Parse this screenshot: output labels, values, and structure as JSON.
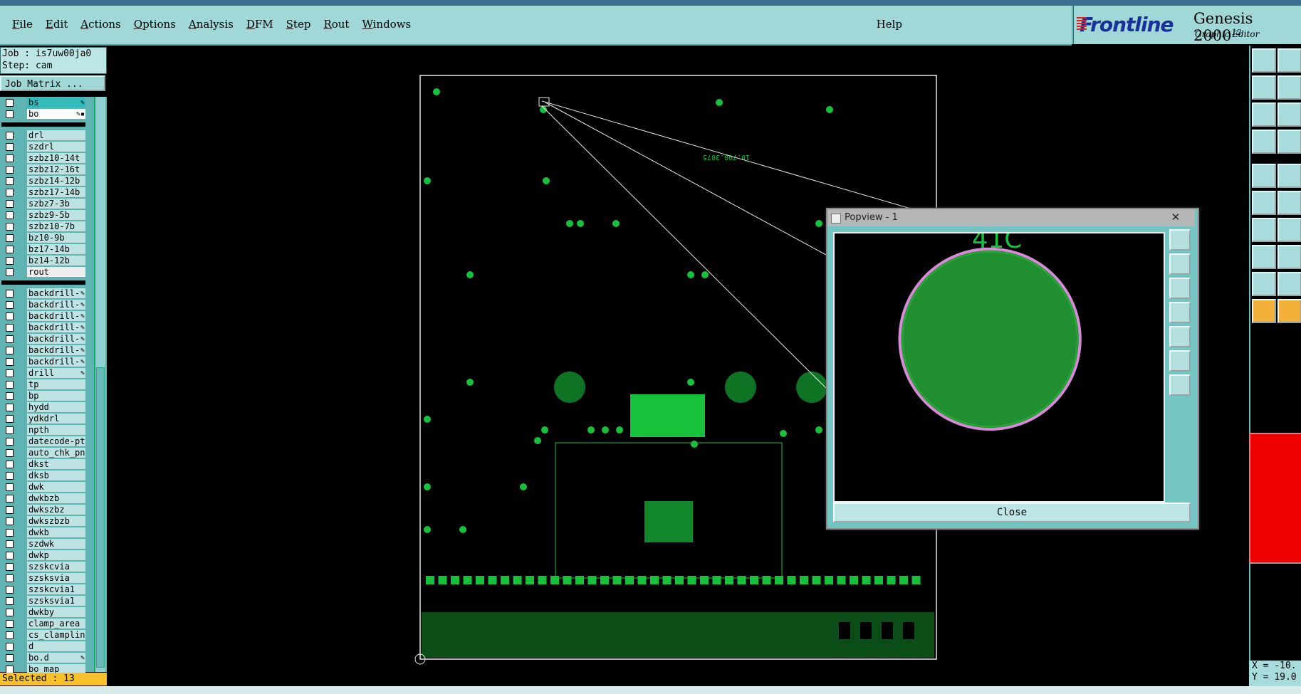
{
  "menu": {
    "items": [
      "File",
      "Edit",
      "Actions",
      "Options",
      "Analysis",
      "DFM",
      "Step",
      "Rout",
      "Windows"
    ],
    "help": "Help"
  },
  "brand": {
    "logo": "Frontline",
    "product": "Genesis 2000",
    "sup": "12",
    "subtitle": "Graphic Editor"
  },
  "job": {
    "job_line": "Job : is7uw00ja0",
    "step_line": "Step: cam"
  },
  "job_matrix_label": "Job Matrix ...",
  "layers_group1": [
    {
      "name": "bs",
      "mark": "✎",
      "style": "bs"
    },
    {
      "name": "bo",
      "mark": "✎▪",
      "style": "sel"
    }
  ],
  "layers_group2": [
    {
      "name": "drl"
    },
    {
      "name": "szdrl"
    },
    {
      "name": "szbz10-14t"
    },
    {
      "name": "szbz12-16t"
    },
    {
      "name": "szbz14-12b"
    },
    {
      "name": "szbz17-14b"
    },
    {
      "name": "szbz7-3b"
    },
    {
      "name": "szbz9-5b"
    },
    {
      "name": "szbz10-7b"
    },
    {
      "name": "bz10-9b"
    },
    {
      "name": "bz17-14b"
    },
    {
      "name": "bz14-12b"
    },
    {
      "name": "rout",
      "style": "rout"
    }
  ],
  "layers_group3": [
    {
      "name": "backdrill-",
      "mark": "✎"
    },
    {
      "name": "backdrill-",
      "mark": "✎"
    },
    {
      "name": "backdrill-",
      "mark": "✎"
    },
    {
      "name": "backdrill-",
      "mark": "✎"
    },
    {
      "name": "backdrill-",
      "mark": "✎"
    },
    {
      "name": "backdrill-",
      "mark": "✎"
    },
    {
      "name": "backdrill-",
      "mark": "✎"
    },
    {
      "name": "drill",
      "mark": "✎"
    },
    {
      "name": "tp"
    },
    {
      "name": "bp"
    },
    {
      "name": "hydd"
    },
    {
      "name": "ydkdrl"
    },
    {
      "name": "npth"
    },
    {
      "name": "datecode-pt"
    },
    {
      "name": "auto_chk_pn"
    },
    {
      "name": "dkst"
    },
    {
      "name": "dksb"
    },
    {
      "name": "dwk"
    },
    {
      "name": "dwkbzb"
    },
    {
      "name": "dwkszbz"
    },
    {
      "name": "dwkszbzb"
    },
    {
      "name": "dwkb"
    },
    {
      "name": "szdwk"
    },
    {
      "name": "dwkp"
    },
    {
      "name": "szskcvia"
    },
    {
      "name": "szsksvia"
    },
    {
      "name": "szskcvia1"
    },
    {
      "name": "szsksvia1"
    },
    {
      "name": "dwkby"
    },
    {
      "name": "clamp_area"
    },
    {
      "name": "cs_clampline"
    },
    {
      "name": "d"
    },
    {
      "name": "bo.d",
      "mark": "✎"
    },
    {
      "name": "bo_map"
    }
  ],
  "selected_label": "Selected : 13",
  "canvas": {
    "board_text": "10.700.3075",
    "colors": {
      "copper": "#17c23a",
      "outline": "#e8e8e8",
      "bg": "#000000"
    }
  },
  "popview": {
    "title": "Popview - 1",
    "close_x": "✕",
    "close_label": "Close",
    "pad_text": "41C"
  },
  "coords": {
    "x": "X = -10.",
    "y": "Y = 19.0"
  }
}
